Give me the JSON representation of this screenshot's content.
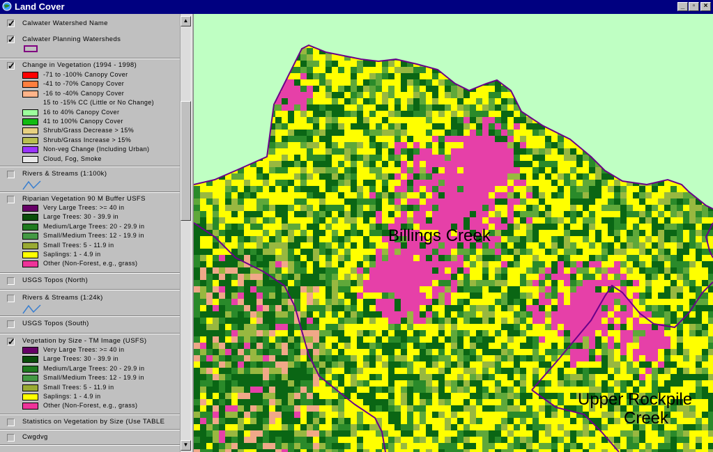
{
  "window": {
    "title": "Land Cover"
  },
  "map": {
    "labels": [
      "Billings Creek",
      "Upper Rockpile",
      "Creek"
    ],
    "colors": {
      "background": "#bfffc3",
      "magenta": "#e640a8",
      "yellow": "#ffff00",
      "dark_green": "#0a6614",
      "medium_green": "#2a8a2a",
      "light_green": "#5fa83a",
      "olive": "#98b840",
      "boundary": "#6a008a"
    }
  },
  "legend": {
    "layers": [
      {
        "label": "Calwater Watershed Name",
        "checked": true
      },
      {
        "label": "Calwater Planning Watersheds",
        "checked": true
      },
      {
        "label": "Change in Vegetation (1994 - 1998)",
        "checked": true,
        "items": [
          {
            "label": "-71 to -100% Canopy Cover",
            "color": "#ff0000"
          },
          {
            "label": "-41 to -70% Canopy Cover",
            "color": "#ff7f3f"
          },
          {
            "label": "-16 to -40% Canopy Cover",
            "color": "#ffb48a"
          },
          {
            "label": "15 to -15% CC (Little or No Change)",
            "color": ""
          },
          {
            "label": "16 to 40% Canopy Cover",
            "color": "#9dff9d"
          },
          {
            "label": "41 to 100% Canopy Cover",
            "color": "#11bb11"
          },
          {
            "label": "Shrub/Grass Decrease > 15%",
            "color": "#e6d080"
          },
          {
            "label": "Shrub/Grass Increase > 15%",
            "color": "#b8c050"
          },
          {
            "label": "Non-veg Change (Including Urban)",
            "color": "#9933ff"
          },
          {
            "label": "Cloud, Fog, Smoke",
            "color": "#e8e8e8"
          }
        ]
      },
      {
        "label": "Rivers & Streams (1:100k)",
        "checked": false
      },
      {
        "label": "Riparian Vegetation 90 M Buffer USFS",
        "checked": false,
        "items": [
          {
            "label": "Very Large Trees: >= 40  in",
            "color": "#660066"
          },
          {
            "label": "Large Trees: 30 - 39.9 in",
            "color": "#0a4d0a"
          },
          {
            "label": "Medium/Large Trees: 20 - 29.9 in",
            "color": "#1f7a1f"
          },
          {
            "label": "Small/Medium Trees: 12 - 19.9 in",
            "color": "#449944"
          },
          {
            "label": "Small Trees: 5 - 11.9 in",
            "color": "#99aa33"
          },
          {
            "label": "Saplings: 1 - 4.9 in",
            "color": "#ffff00"
          },
          {
            "label": "Other (Non-Forest, e.g., grass)",
            "color": "#ee3399"
          }
        ]
      },
      {
        "label": "USGS Topos (North)",
        "checked": false
      },
      {
        "label": "Rivers & Streams (1:24k)",
        "checked": false
      },
      {
        "label": "USGS Topos (South)",
        "checked": false
      },
      {
        "label": "Vegetation by Size - TM Image (USFS)",
        "checked": true,
        "items": [
          {
            "label": "Very Large Trees: >= 40  in",
            "color": "#660066"
          },
          {
            "label": "Large Trees: 30 - 39.9 in",
            "color": "#0a4d0a"
          },
          {
            "label": "Medium/Large Trees: 20 - 29.9 in",
            "color": "#1f7a1f"
          },
          {
            "label": "Small/Medium Trees: 12 - 19.9 in",
            "color": "#449944"
          },
          {
            "label": "Small Trees: 5 - 11.9 in",
            "color": "#99aa33"
          },
          {
            "label": "Saplings: 1 - 4.9 in",
            "color": "#ffff00"
          },
          {
            "label": "Other (Non-Forest, e.g., grass)",
            "color": "#ee3399"
          }
        ]
      },
      {
        "label": "Statistics on Vegetation by Size (Use TABLE",
        "checked": false
      },
      {
        "label": "Cwgdvg",
        "checked": false
      }
    ]
  }
}
